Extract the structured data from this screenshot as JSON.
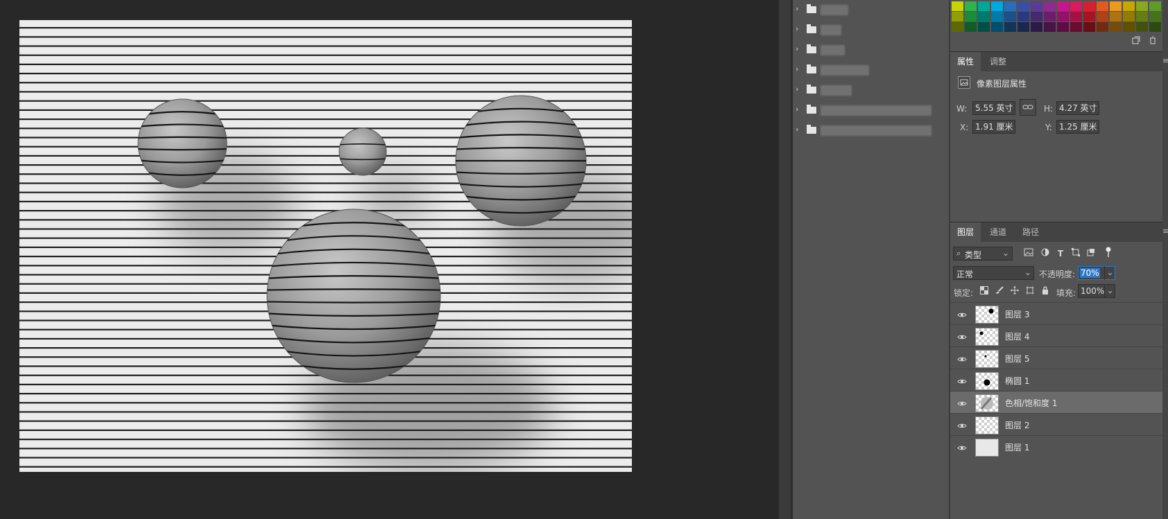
{
  "canvas": {
    "stripe_count": 49,
    "spheres": [
      {
        "name": "sphere-top-left",
        "stripes": 6
      },
      {
        "name": "sphere-small",
        "stripes": 2
      },
      {
        "name": "sphere-top-right",
        "stripes": 9
      },
      {
        "name": "sphere-large",
        "stripes": 12
      }
    ]
  },
  "folders": {
    "count": 7,
    "chevron": "›"
  },
  "swatch_tools": {
    "new_icon": "new-swatch-icon",
    "delete_icon": "trash-icon"
  },
  "properties": {
    "tabs": [
      "属性",
      "调整"
    ],
    "heading": "像素图层属性",
    "w_label": "W:",
    "w_value": "5.55 英寸",
    "h_label": "H:",
    "h_value": "4.27 英寸",
    "x_label": "X:",
    "x_value": "1.91 厘米",
    "y_label": "Y:",
    "y_value": "1.25 厘米"
  },
  "layers": {
    "tabs": [
      "图层",
      "通道",
      "路径"
    ],
    "filter_kind": "类型",
    "blend_mode": "正常",
    "opacity_label": "不透明度:",
    "opacity_value": "70%",
    "lock_label": "锁定:",
    "fill_label": "填充:",
    "fill_value": "100%",
    "items": [
      {
        "name": "图层 3",
        "thumb": "dot-top-right",
        "selected": false
      },
      {
        "name": "图层 4",
        "thumb": "dot-top-left",
        "selected": false
      },
      {
        "name": "图层 5",
        "thumb": "dot-small",
        "selected": false
      },
      {
        "name": "椭圆 1",
        "thumb": "ellipse",
        "selected": false
      },
      {
        "name": "色相/饱和度 1",
        "thumb": "adjustment",
        "selected": true
      },
      {
        "name": "图层 2",
        "thumb": "transparent",
        "selected": false
      },
      {
        "name": "图层 1",
        "thumb": "plain",
        "selected": false
      }
    ]
  },
  "colors": {
    "app_bg": "#282828",
    "panel_bg": "#535353",
    "tab_bg": "#434343",
    "selected_row": "#6b6b6b",
    "highlight": "#2f78c8"
  }
}
